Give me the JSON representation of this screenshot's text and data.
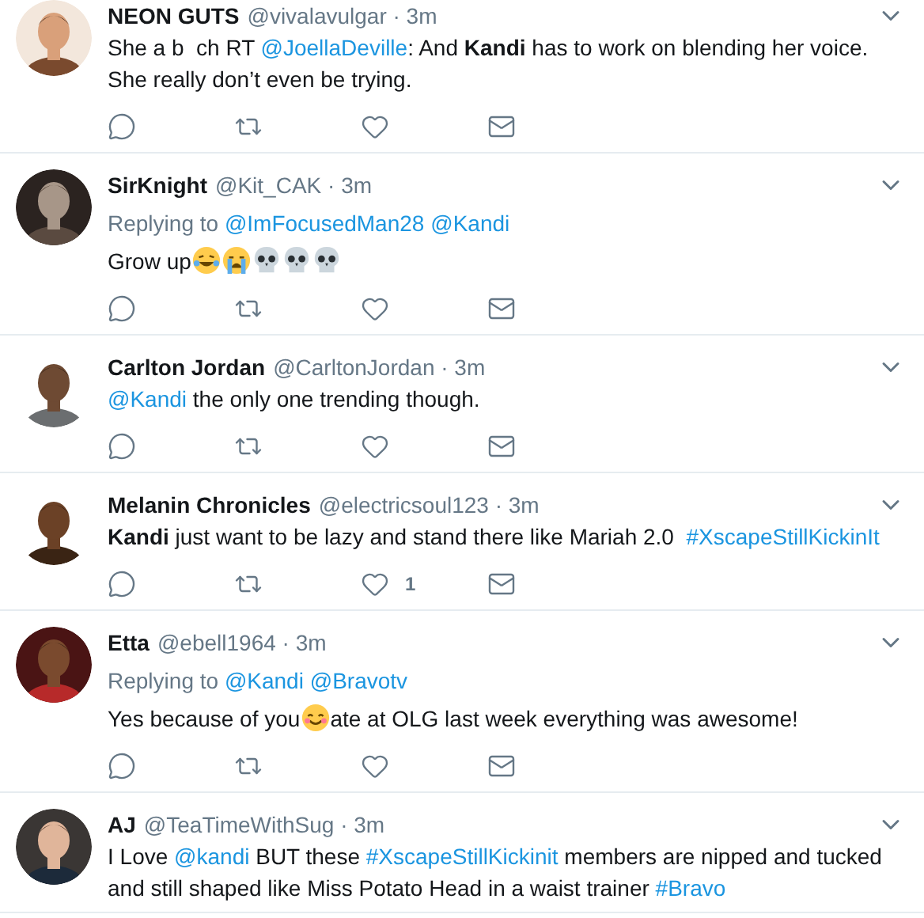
{
  "tweets": [
    {
      "name": "NEON GUTS",
      "meta": "@vivalavulgar · 3m",
      "body": [
        {
          "kind": "plain",
          "text": "She a b  ch RT "
        },
        {
          "kind": "link",
          "text": "@JoellaDeville"
        },
        {
          "kind": "plain",
          "text": ": And "
        },
        {
          "kind": "bold",
          "text": "Kandi"
        },
        {
          "kind": "plain",
          "text": " has to work on blending her voice. She really don’t even be trying."
        }
      ]
    },
    {
      "name": "SirKnight",
      "meta": "@Kit_CAK · 3m",
      "reply_to": {
        "label": "Replying to ",
        "links": [
          "@ImFocusedMan28",
          "@Kandi"
        ]
      },
      "body": [
        {
          "kind": "plain",
          "text": "Grow up"
        },
        {
          "kind": "laugh"
        },
        {
          "kind": "cry"
        },
        {
          "kind": "skull"
        },
        {
          "kind": "skull"
        },
        {
          "kind": "skull"
        }
      ]
    },
    {
      "name": "Carlton Jordan",
      "meta": "@CarltonJordan · 3m",
      "body": [
        {
          "kind": "link",
          "text": "@Kandi"
        },
        {
          "kind": "plain",
          "text": " the only one trending though."
        }
      ]
    },
    {
      "name": "Melanin Chronicles",
      "meta": "@electricsoul123 · 3m",
      "body": [
        {
          "kind": "bold",
          "text": "Kandi"
        },
        {
          "kind": "plain",
          "text": " just want to be lazy and stand there like Mariah 2.0  "
        },
        {
          "kind": "link",
          "text": "#XscapeStillKickinIt"
        }
      ],
      "likes": "1"
    },
    {
      "name": "Etta",
      "meta": "@ebell1964 · 3m",
      "reply_to": {
        "label": "Replying to ",
        "links": [
          "@Kandi",
          "@Bravotv"
        ]
      },
      "body": [
        {
          "kind": "plain",
          "text": "Yes because of you"
        },
        {
          "kind": "smile"
        },
        {
          "kind": "plain",
          "text": "ate at OLG last week everything was awesome!"
        }
      ]
    },
    {
      "name": "AJ",
      "meta": "@TeaTimeWithSug · 3m",
      "actions_cut_off": true,
      "body": [
        {
          "kind": "plain",
          "text": "I Love "
        },
        {
          "kind": "link",
          "text": "@kandi"
        },
        {
          "kind": "plain",
          "text": " BUT these "
        },
        {
          "kind": "link",
          "text": "#XscapeStillKickinit"
        },
        {
          "kind": "plain",
          "text": " members are nipped and tucked and still shaped like Miss Potato Head in a waist trainer "
        },
        {
          "kind": "link",
          "text": "#Bravo"
        }
      ]
    }
  ]
}
